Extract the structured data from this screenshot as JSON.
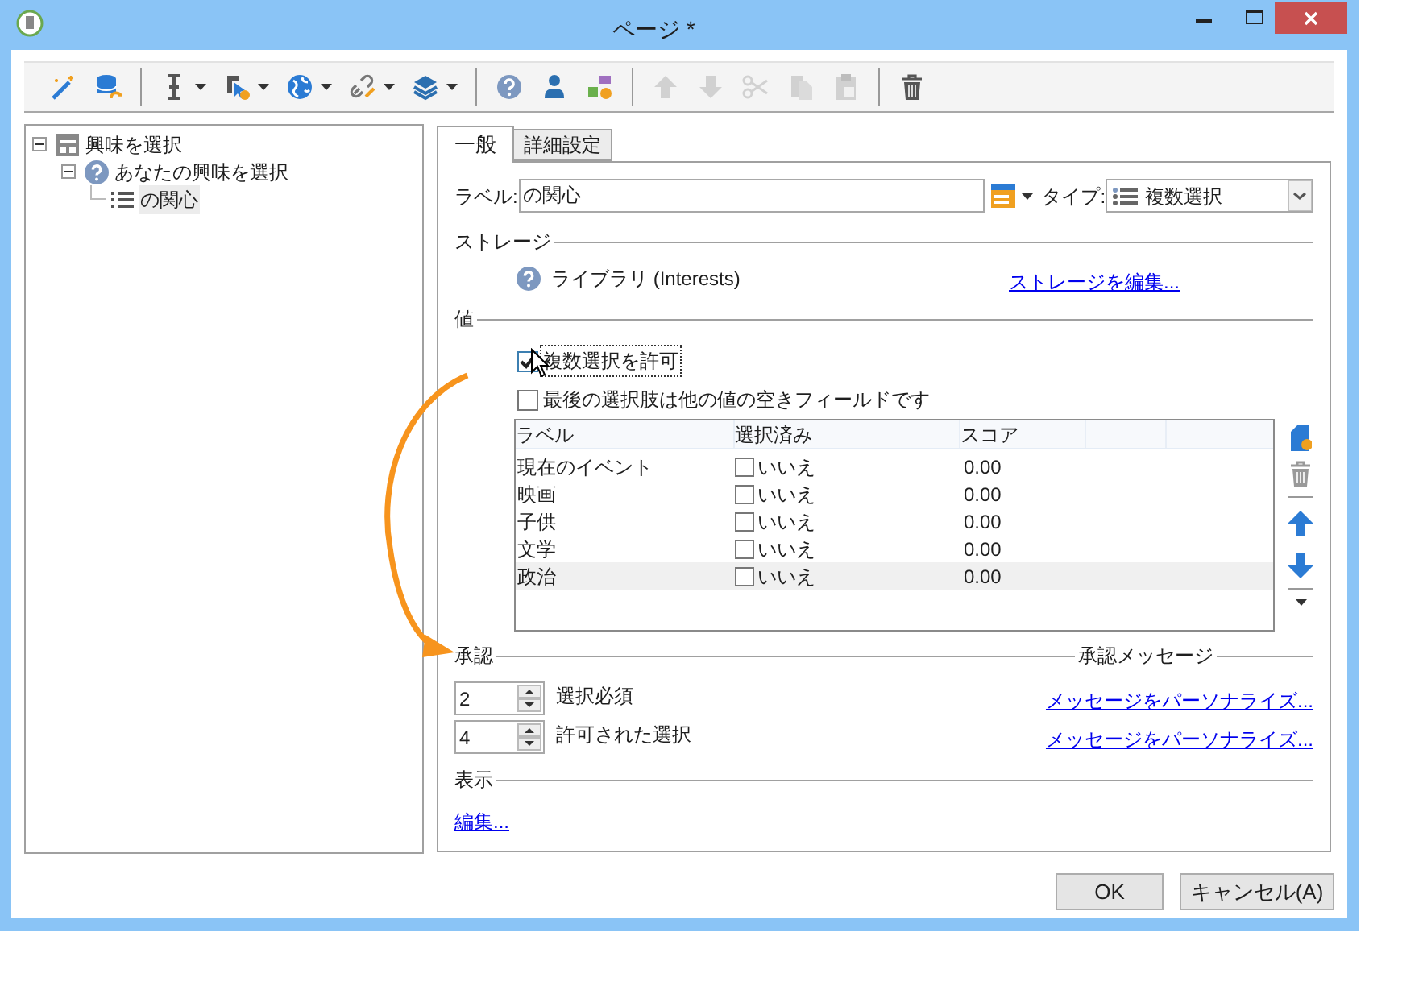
{
  "window": {
    "title": "ページ *"
  },
  "toolbar": {
    "groups": [
      {
        "items": [
          {
            "dropdown": false,
            "disabled": false
          },
          {
            "dropdown": false,
            "disabled": false
          }
        ]
      },
      {
        "items": [
          {
            "dropdown": true,
            "disabled": false
          },
          {
            "dropdown": true,
            "disabled": false
          },
          {
            "dropdown": true,
            "disabled": false
          },
          {
            "dropdown": true,
            "disabled": false
          },
          {
            "dropdown": true,
            "disabled": false
          }
        ]
      },
      {
        "items": [
          {
            "dropdown": false,
            "disabled": false
          },
          {
            "dropdown": false,
            "disabled": false
          },
          {
            "dropdown": false,
            "disabled": false
          }
        ]
      },
      {
        "items": [
          {
            "dropdown": false,
            "disabled": true
          },
          {
            "dropdown": false,
            "disabled": true
          },
          {
            "dropdown": false,
            "disabled": true
          },
          {
            "dropdown": false,
            "disabled": true
          },
          {
            "dropdown": false,
            "disabled": true
          }
        ]
      },
      {
        "items": [
          {
            "dropdown": false,
            "disabled": false
          }
        ]
      }
    ]
  },
  "tree": [
    {
      "label": "興味を選択",
      "expanded": true,
      "selected": false,
      "children": [
        {
          "label": "あなたの興味を選択",
          "expanded": true,
          "selected": false,
          "children": [
            {
              "label": "の関心",
              "selected": true
            }
          ]
        }
      ]
    }
  ],
  "tabs": [
    {
      "label": "一般",
      "selected": true
    },
    {
      "label": "詳細設定",
      "selected": false
    }
  ],
  "label_field": {
    "label": "ラベル:",
    "value": "の関心"
  },
  "type_field": {
    "label": "タイプ:",
    "value": "複数選択"
  },
  "storage": {
    "title": "ストレージ",
    "value": "ライブラリ (Interests)",
    "link": "ストレージを編集..."
  },
  "values": {
    "title": "値",
    "checkboxes": [
      {
        "label": "複数選択を許可",
        "checked": true,
        "focused": true
      },
      {
        "label": "最後の選択肢は他の値の空きフィールドです",
        "checked": false,
        "focused": false
      }
    ],
    "table": {
      "columns": [
        "ラベル",
        "選択済み",
        "スコア"
      ],
      "rows": [
        {
          "label": "現在のイベント",
          "checked": false,
          "chosen": "いいえ",
          "score": "0.00",
          "selected": false
        },
        {
          "label": "映画",
          "checked": false,
          "chosen": "いいえ",
          "score": "0.00",
          "selected": false
        },
        {
          "label": "子供",
          "checked": false,
          "chosen": "いいえ",
          "score": "0.00",
          "selected": false
        },
        {
          "label": "文学",
          "checked": false,
          "chosen": "いいえ",
          "score": "0.00",
          "selected": false
        },
        {
          "label": "政治",
          "checked": false,
          "chosen": "いいえ",
          "score": "0.00",
          "selected": true
        }
      ]
    }
  },
  "validation": {
    "title": "承認",
    "message_title": "承認メッセージ",
    "spinners": [
      {
        "value": "2",
        "label": "選択必須",
        "link": "メッセージをパーソナライズ..."
      },
      {
        "value": "4",
        "label": "許可された選択",
        "link": "メッセージをパーソナライズ..."
      }
    ]
  },
  "display": {
    "title": "表示",
    "link": "編集..."
  },
  "buttons": [
    {
      "label": "OK"
    },
    {
      "label": "キャンセル(A)"
    }
  ]
}
